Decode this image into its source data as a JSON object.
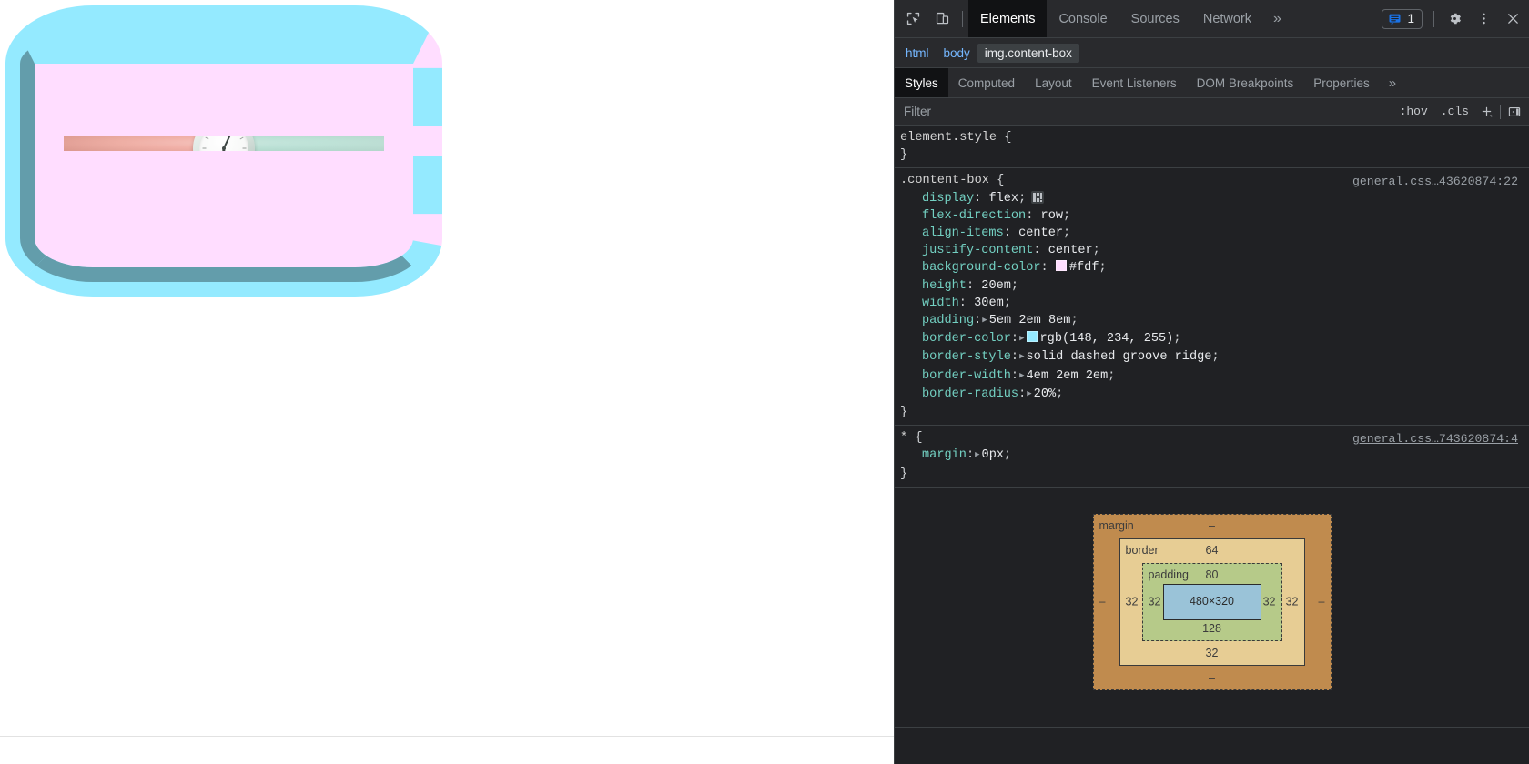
{
  "window": {
    "page_background": "#ffffff",
    "devtools_background": "#202124"
  },
  "page": {
    "element": {
      "tag": "img",
      "class": "content-box",
      "alt_photo": "alarm-clock-on-pink-and-mint-split-background"
    }
  },
  "devtools": {
    "toolbar": {
      "inspect_icon": "inspect-cursor-icon",
      "device_toolbar_icon": "device-toggle-icon",
      "tabs": [
        {
          "label": "Elements",
          "active": true
        },
        {
          "label": "Console",
          "active": false
        },
        {
          "label": "Sources",
          "active": false
        },
        {
          "label": "Network",
          "active": false
        }
      ],
      "more_tabs_label": "»",
      "issues": {
        "icon": "issues-message-icon",
        "count": "1"
      },
      "settings_icon": "gear-icon",
      "menu_icon": "kebab-menu-icon",
      "close_icon": "close-icon"
    },
    "breadcrumb": [
      {
        "label": "html",
        "selected": false
      },
      {
        "label": "body",
        "selected": false
      },
      {
        "label": "img.content-box",
        "selected": true
      }
    ],
    "sidebar_tabs": [
      {
        "label": "Styles",
        "active": true
      },
      {
        "label": "Computed",
        "active": false
      },
      {
        "label": "Layout",
        "active": false
      },
      {
        "label": "Event Listeners",
        "active": false
      },
      {
        "label": "DOM Breakpoints",
        "active": false
      },
      {
        "label": "Properties",
        "active": false
      }
    ],
    "sidebar_tabs_more": "»",
    "filter_bar": {
      "placeholder": "Filter",
      "value": "",
      "hov_label": ":hov",
      "cls_label": ".cls",
      "new_rule_label": "+",
      "toggle_sidebar_icon": "toggle-right-panel-icon"
    },
    "rules": [
      {
        "selector": "element.style",
        "source": "",
        "declarations": []
      },
      {
        "selector": ".content-box",
        "source": "general.css…43620874:22",
        "declarations": [
          {
            "property": "display",
            "value": "flex",
            "expandable": false,
            "badge": "flex-badge"
          },
          {
            "property": "flex-direction",
            "value": "row",
            "expandable": false
          },
          {
            "property": "align-items",
            "value": "center",
            "expandable": false
          },
          {
            "property": "justify-content",
            "value": "center",
            "expandable": false
          },
          {
            "property": "background-color",
            "value": "#fdf",
            "expandable": false,
            "swatch": "#ffddff"
          },
          {
            "property": "height",
            "value": "20em",
            "expandable": false
          },
          {
            "property": "width",
            "value": "30em",
            "expandable": false
          },
          {
            "property": "padding",
            "value": "5em 2em 8em",
            "expandable": true
          },
          {
            "property": "border-color",
            "value": "rgb(148, 234, 255)",
            "expandable": true,
            "swatch": "#94eaff"
          },
          {
            "property": "border-style",
            "value": "solid dashed groove ridge",
            "expandable": true
          },
          {
            "property": "border-width",
            "value": "4em 2em 2em",
            "expandable": true
          },
          {
            "property": "border-radius",
            "value": "20%",
            "expandable": true
          }
        ]
      },
      {
        "selector": "*",
        "source": "general.css…743620874:4",
        "declarations": [
          {
            "property": "margin",
            "value": "0px",
            "expandable": true
          }
        ]
      }
    ],
    "box_model": {
      "margin": {
        "label": "margin",
        "top": "–",
        "right": "–",
        "bottom": "–",
        "left": "–"
      },
      "border": {
        "label": "border",
        "top": "64",
        "right": "32",
        "bottom": "32",
        "left": "32"
      },
      "padding": {
        "label": "padding",
        "top": "80",
        "right": "32",
        "bottom": "128",
        "left": "32"
      },
      "content": {
        "size": "480×320"
      }
    }
  }
}
